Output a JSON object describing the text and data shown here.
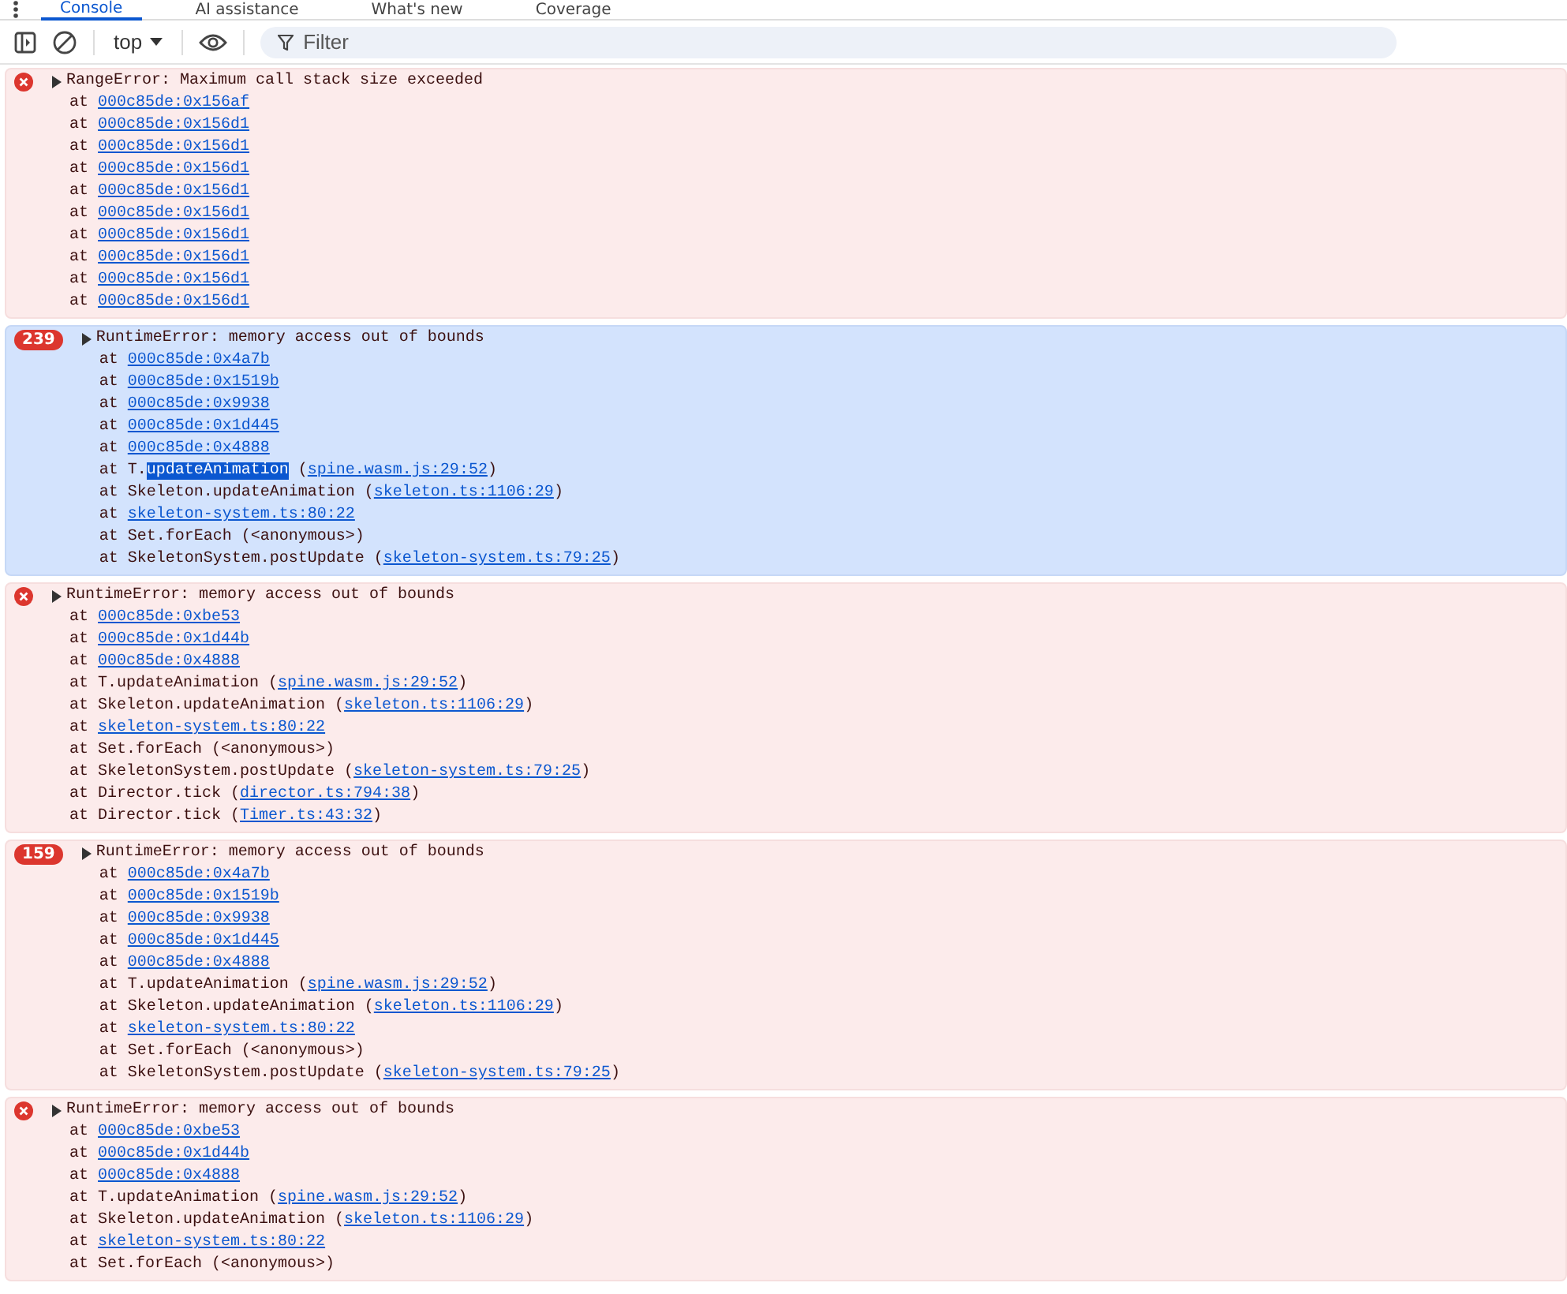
{
  "tabs": [
    {
      "label": "Console",
      "selected": true
    },
    {
      "label": "AI assistance",
      "selected": false
    },
    {
      "label": "What's new",
      "selected": false
    },
    {
      "label": "Coverage",
      "selected": false
    }
  ],
  "toolbar": {
    "context": "top",
    "filter": {
      "placeholder": "Filter"
    }
  },
  "messages": [
    {
      "selected": false,
      "text": "RangeError: Maximum call stack size exceeded",
      "frames": [
        [
          {
            "kind": "plain",
            "text": "at "
          },
          {
            "kind": "link",
            "text": "000c85de:0x156af"
          }
        ],
        [
          {
            "kind": "plain",
            "text": "at "
          },
          {
            "kind": "link",
            "text": "000c85de:0x156d1"
          }
        ],
        [
          {
            "kind": "plain",
            "text": "at "
          },
          {
            "kind": "link",
            "text": "000c85de:0x156d1"
          }
        ],
        [
          {
            "kind": "plain",
            "text": "at "
          },
          {
            "kind": "link",
            "text": "000c85de:0x156d1"
          }
        ],
        [
          {
            "kind": "plain",
            "text": "at "
          },
          {
            "kind": "link",
            "text": "000c85de:0x156d1"
          }
        ],
        [
          {
            "kind": "plain",
            "text": "at "
          },
          {
            "kind": "link",
            "text": "000c85de:0x156d1"
          }
        ],
        [
          {
            "kind": "plain",
            "text": "at "
          },
          {
            "kind": "link",
            "text": "000c85de:0x156d1"
          }
        ],
        [
          {
            "kind": "plain",
            "text": "at "
          },
          {
            "kind": "link",
            "text": "000c85de:0x156d1"
          }
        ],
        [
          {
            "kind": "plain",
            "text": "at "
          },
          {
            "kind": "link",
            "text": "000c85de:0x156d1"
          }
        ],
        [
          {
            "kind": "plain",
            "text": "at "
          },
          {
            "kind": "link",
            "text": "000c85de:0x156d1"
          }
        ]
      ]
    },
    {
      "count": "239",
      "selected": true,
      "text": "RuntimeError: memory access out of bounds",
      "frames": [
        [
          {
            "kind": "plain",
            "text": "at "
          },
          {
            "kind": "link",
            "text": "000c85de:0x4a7b"
          }
        ],
        [
          {
            "kind": "plain",
            "text": "at "
          },
          {
            "kind": "link",
            "text": "000c85de:0x1519b"
          }
        ],
        [
          {
            "kind": "plain",
            "text": "at "
          },
          {
            "kind": "link",
            "text": "000c85de:0x9938"
          }
        ],
        [
          {
            "kind": "plain",
            "text": "at "
          },
          {
            "kind": "link",
            "text": "000c85de:0x1d445"
          }
        ],
        [
          {
            "kind": "plain",
            "text": "at "
          },
          {
            "kind": "link",
            "text": "000c85de:0x4888"
          }
        ],
        [
          {
            "kind": "plain",
            "text": "at T."
          },
          {
            "kind": "selection",
            "text": "updateAnimation"
          },
          {
            "kind": "plain",
            "text": " ("
          },
          {
            "kind": "link",
            "text": "spine.wasm.js:29:52"
          },
          {
            "kind": "plain",
            "text": ")"
          }
        ],
        [
          {
            "kind": "plain",
            "text": "at Skeleton.updateAnimation ("
          },
          {
            "kind": "link",
            "text": "skeleton.ts:1106:29"
          },
          {
            "kind": "plain",
            "text": ")"
          }
        ],
        [
          {
            "kind": "plain",
            "text": "at "
          },
          {
            "kind": "link",
            "text": "skeleton-system.ts:80:22"
          }
        ],
        [
          {
            "kind": "plain",
            "text": "at Set.forEach (<anonymous>)"
          }
        ],
        [
          {
            "kind": "plain",
            "text": "at SkeletonSystem.postUpdate ("
          },
          {
            "kind": "link",
            "text": "skeleton-system.ts:79:25"
          },
          {
            "kind": "plain",
            "text": ")"
          }
        ]
      ]
    },
    {
      "selected": false,
      "text": "RuntimeError: memory access out of bounds",
      "frames": [
        [
          {
            "kind": "plain",
            "text": "at "
          },
          {
            "kind": "link",
            "text": "000c85de:0xbe53"
          }
        ],
        [
          {
            "kind": "plain",
            "text": "at "
          },
          {
            "kind": "link",
            "text": "000c85de:0x1d44b"
          }
        ],
        [
          {
            "kind": "plain",
            "text": "at "
          },
          {
            "kind": "link",
            "text": "000c85de:0x4888"
          }
        ],
        [
          {
            "kind": "plain",
            "text": "at T.updateAnimation ("
          },
          {
            "kind": "link",
            "text": "spine.wasm.js:29:52"
          },
          {
            "kind": "plain",
            "text": ")"
          }
        ],
        [
          {
            "kind": "plain",
            "text": "at Skeleton.updateAnimation ("
          },
          {
            "kind": "link",
            "text": "skeleton.ts:1106:29"
          },
          {
            "kind": "plain",
            "text": ")"
          }
        ],
        [
          {
            "kind": "plain",
            "text": "at "
          },
          {
            "kind": "link",
            "text": "skeleton-system.ts:80:22"
          }
        ],
        [
          {
            "kind": "plain",
            "text": "at Set.forEach (<anonymous>)"
          }
        ],
        [
          {
            "kind": "plain",
            "text": "at SkeletonSystem.postUpdate ("
          },
          {
            "kind": "link",
            "text": "skeleton-system.ts:79:25"
          },
          {
            "kind": "plain",
            "text": ")"
          }
        ],
        [
          {
            "kind": "plain",
            "text": "at Director.tick ("
          },
          {
            "kind": "link",
            "text": "director.ts:794:38"
          },
          {
            "kind": "plain",
            "text": ")"
          }
        ],
        [
          {
            "kind": "plain",
            "text": "at Director.tick ("
          },
          {
            "kind": "link",
            "text": "Timer.ts:43:32"
          },
          {
            "kind": "plain",
            "text": ")"
          }
        ]
      ]
    },
    {
      "count": "159",
      "selected": false,
      "text": "RuntimeError: memory access out of bounds",
      "frames": [
        [
          {
            "kind": "plain",
            "text": "at "
          },
          {
            "kind": "link",
            "text": "000c85de:0x4a7b"
          }
        ],
        [
          {
            "kind": "plain",
            "text": "at "
          },
          {
            "kind": "link",
            "text": "000c85de:0x1519b"
          }
        ],
        [
          {
            "kind": "plain",
            "text": "at "
          },
          {
            "kind": "link",
            "text": "000c85de:0x9938"
          }
        ],
        [
          {
            "kind": "plain",
            "text": "at "
          },
          {
            "kind": "link",
            "text": "000c85de:0x1d445"
          }
        ],
        [
          {
            "kind": "plain",
            "text": "at "
          },
          {
            "kind": "link",
            "text": "000c85de:0x4888"
          }
        ],
        [
          {
            "kind": "plain",
            "text": "at T.updateAnimation ("
          },
          {
            "kind": "link",
            "text": "spine.wasm.js:29:52"
          },
          {
            "kind": "plain",
            "text": ")"
          }
        ],
        [
          {
            "kind": "plain",
            "text": "at Skeleton.updateAnimation ("
          },
          {
            "kind": "link",
            "text": "skeleton.ts:1106:29"
          },
          {
            "kind": "plain",
            "text": ")"
          }
        ],
        [
          {
            "kind": "plain",
            "text": "at "
          },
          {
            "kind": "link",
            "text": "skeleton-system.ts:80:22"
          }
        ],
        [
          {
            "kind": "plain",
            "text": "at Set.forEach (<anonymous>)"
          }
        ],
        [
          {
            "kind": "plain",
            "text": "at SkeletonSystem.postUpdate ("
          },
          {
            "kind": "link",
            "text": "skeleton-system.ts:79:25"
          },
          {
            "kind": "plain",
            "text": ")"
          }
        ]
      ]
    },
    {
      "selected": false,
      "text": "RuntimeError: memory access out of bounds",
      "frames": [
        [
          {
            "kind": "plain",
            "text": "at "
          },
          {
            "kind": "link",
            "text": "000c85de:0xbe53"
          }
        ],
        [
          {
            "kind": "plain",
            "text": "at "
          },
          {
            "kind": "link",
            "text": "000c85de:0x1d44b"
          }
        ],
        [
          {
            "kind": "plain",
            "text": "at "
          },
          {
            "kind": "link",
            "text": "000c85de:0x4888"
          }
        ],
        [
          {
            "kind": "plain",
            "text": "at T.updateAnimation ("
          },
          {
            "kind": "link",
            "text": "spine.wasm.js:29:52"
          },
          {
            "kind": "plain",
            "text": ")"
          }
        ],
        [
          {
            "kind": "plain",
            "text": "at Skeleton.updateAnimation ("
          },
          {
            "kind": "link",
            "text": "skeleton.ts:1106:29"
          },
          {
            "kind": "plain",
            "text": ")"
          }
        ],
        [
          {
            "kind": "plain",
            "text": "at "
          },
          {
            "kind": "link",
            "text": "skeleton-system.ts:80:22"
          }
        ],
        [
          {
            "kind": "plain",
            "text": "at Set.forEach (<anonymous>)"
          }
        ]
      ]
    }
  ]
}
